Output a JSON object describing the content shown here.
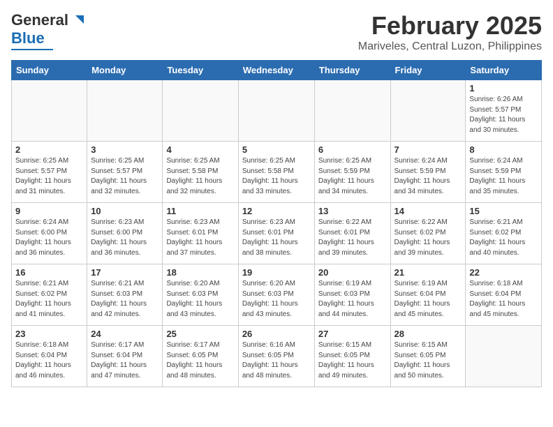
{
  "header": {
    "logo_line1": "General",
    "logo_line2": "Blue",
    "title": "February 2025",
    "subtitle": "Mariveles, Central Luzon, Philippines"
  },
  "days_of_week": [
    "Sunday",
    "Monday",
    "Tuesday",
    "Wednesday",
    "Thursday",
    "Friday",
    "Saturday"
  ],
  "weeks": [
    [
      {
        "day": "",
        "info": ""
      },
      {
        "day": "",
        "info": ""
      },
      {
        "day": "",
        "info": ""
      },
      {
        "day": "",
        "info": ""
      },
      {
        "day": "",
        "info": ""
      },
      {
        "day": "",
        "info": ""
      },
      {
        "day": "1",
        "info": "Sunrise: 6:26 AM\nSunset: 5:57 PM\nDaylight: 11 hours\nand 30 minutes."
      }
    ],
    [
      {
        "day": "2",
        "info": "Sunrise: 6:25 AM\nSunset: 5:57 PM\nDaylight: 11 hours\nand 31 minutes."
      },
      {
        "day": "3",
        "info": "Sunrise: 6:25 AM\nSunset: 5:57 PM\nDaylight: 11 hours\nand 32 minutes."
      },
      {
        "day": "4",
        "info": "Sunrise: 6:25 AM\nSunset: 5:58 PM\nDaylight: 11 hours\nand 32 minutes."
      },
      {
        "day": "5",
        "info": "Sunrise: 6:25 AM\nSunset: 5:58 PM\nDaylight: 11 hours\nand 33 minutes."
      },
      {
        "day": "6",
        "info": "Sunrise: 6:25 AM\nSunset: 5:59 PM\nDaylight: 11 hours\nand 34 minutes."
      },
      {
        "day": "7",
        "info": "Sunrise: 6:24 AM\nSunset: 5:59 PM\nDaylight: 11 hours\nand 34 minutes."
      },
      {
        "day": "8",
        "info": "Sunrise: 6:24 AM\nSunset: 5:59 PM\nDaylight: 11 hours\nand 35 minutes."
      }
    ],
    [
      {
        "day": "9",
        "info": "Sunrise: 6:24 AM\nSunset: 6:00 PM\nDaylight: 11 hours\nand 36 minutes."
      },
      {
        "day": "10",
        "info": "Sunrise: 6:23 AM\nSunset: 6:00 PM\nDaylight: 11 hours\nand 36 minutes."
      },
      {
        "day": "11",
        "info": "Sunrise: 6:23 AM\nSunset: 6:01 PM\nDaylight: 11 hours\nand 37 minutes."
      },
      {
        "day": "12",
        "info": "Sunrise: 6:23 AM\nSunset: 6:01 PM\nDaylight: 11 hours\nand 38 minutes."
      },
      {
        "day": "13",
        "info": "Sunrise: 6:22 AM\nSunset: 6:01 PM\nDaylight: 11 hours\nand 39 minutes."
      },
      {
        "day": "14",
        "info": "Sunrise: 6:22 AM\nSunset: 6:02 PM\nDaylight: 11 hours\nand 39 minutes."
      },
      {
        "day": "15",
        "info": "Sunrise: 6:21 AM\nSunset: 6:02 PM\nDaylight: 11 hours\nand 40 minutes."
      }
    ],
    [
      {
        "day": "16",
        "info": "Sunrise: 6:21 AM\nSunset: 6:02 PM\nDaylight: 11 hours\nand 41 minutes."
      },
      {
        "day": "17",
        "info": "Sunrise: 6:21 AM\nSunset: 6:03 PM\nDaylight: 11 hours\nand 42 minutes."
      },
      {
        "day": "18",
        "info": "Sunrise: 6:20 AM\nSunset: 6:03 PM\nDaylight: 11 hours\nand 43 minutes."
      },
      {
        "day": "19",
        "info": "Sunrise: 6:20 AM\nSunset: 6:03 PM\nDaylight: 11 hours\nand 43 minutes."
      },
      {
        "day": "20",
        "info": "Sunrise: 6:19 AM\nSunset: 6:03 PM\nDaylight: 11 hours\nand 44 minutes."
      },
      {
        "day": "21",
        "info": "Sunrise: 6:19 AM\nSunset: 6:04 PM\nDaylight: 11 hours\nand 45 minutes."
      },
      {
        "day": "22",
        "info": "Sunrise: 6:18 AM\nSunset: 6:04 PM\nDaylight: 11 hours\nand 45 minutes."
      }
    ],
    [
      {
        "day": "23",
        "info": "Sunrise: 6:18 AM\nSunset: 6:04 PM\nDaylight: 11 hours\nand 46 minutes."
      },
      {
        "day": "24",
        "info": "Sunrise: 6:17 AM\nSunset: 6:04 PM\nDaylight: 11 hours\nand 47 minutes."
      },
      {
        "day": "25",
        "info": "Sunrise: 6:17 AM\nSunset: 6:05 PM\nDaylight: 11 hours\nand 48 minutes."
      },
      {
        "day": "26",
        "info": "Sunrise: 6:16 AM\nSunset: 6:05 PM\nDaylight: 11 hours\nand 48 minutes."
      },
      {
        "day": "27",
        "info": "Sunrise: 6:15 AM\nSunset: 6:05 PM\nDaylight: 11 hours\nand 49 minutes."
      },
      {
        "day": "28",
        "info": "Sunrise: 6:15 AM\nSunset: 6:05 PM\nDaylight: 11 hours\nand 50 minutes."
      },
      {
        "day": "",
        "info": ""
      }
    ]
  ]
}
